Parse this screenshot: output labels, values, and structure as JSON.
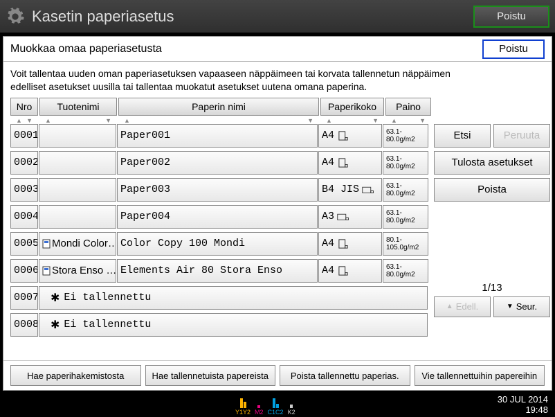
{
  "titlebar": {
    "title": "Kasetin paperiasetus",
    "exit": "Poistu"
  },
  "panel": {
    "title": "Muokkaa omaa paperiasetusta",
    "exit": "Poistu",
    "info1": "Voit tallentaa uuden oman paperiasetuksen vapaaseen näppäimeen tai korvata tallennetun näppäimen",
    "info2": "edelliset asetukset uusilla tai tallentaa muokatut asetukset uutena omana paperina."
  },
  "headers": {
    "nro": "Nro",
    "tuotenimi": "Tuotenimi",
    "paperin_nimi": "Paperin nimi",
    "paperikoko": "Paperikoko",
    "paino": "Paino"
  },
  "rows": [
    {
      "num": "0001",
      "brand": "",
      "pname": "Paper001",
      "psize": "A4",
      "icon": "portrait-dog",
      "w1": "63.1-",
      "w2": "80.0g/m2"
    },
    {
      "num": "0002",
      "brand": "",
      "pname": "Paper002",
      "psize": "A4",
      "icon": "portrait-dog",
      "w1": "63.1-",
      "w2": "80.0g/m2"
    },
    {
      "num": "0003",
      "brand": "",
      "pname": "Paper003",
      "psize": "B4 JIS",
      "icon": "landscape-dog",
      "w1": "63.1-",
      "w2": "80.0g/m2"
    },
    {
      "num": "0004",
      "brand": "",
      "pname": "Paper004",
      "psize": "A3",
      "icon": "landscape-dog",
      "w1": "63.1-",
      "w2": "80.0g/m2"
    },
    {
      "num": "0005",
      "brand": "Mondi Color…",
      "brand_icon": true,
      "pname": "Color Copy 100 Mondi",
      "psize": "A4",
      "icon": "portrait-dog",
      "w1": "80.1-",
      "w2": "105.0g/m2"
    },
    {
      "num": "0006",
      "brand": "Stora Enso …",
      "brand_icon": true,
      "pname": "Elements Air 80 Stora Enso",
      "psize": "A4",
      "icon": "portrait-dog",
      "w1": "63.1-",
      "w2": "80.0g/m2"
    },
    {
      "num": "0007",
      "notstored": "Ei tallennettu"
    },
    {
      "num": "0008",
      "notstored": "Ei tallennettu"
    }
  ],
  "side": {
    "etsi": "Etsi",
    "peruuta": "Peruuta",
    "tulosta": "Tulosta asetukset",
    "poista": "Poista"
  },
  "pager": {
    "num": "1/13",
    "prev": "Edell.",
    "next": "Seur."
  },
  "bottom": {
    "b1": "Hae paperihakemistosta",
    "b2": "Hae tallennetuista papereista",
    "b3": "Poista tallennettu paperias.",
    "b4": "Vie tallennettuihin papereihin"
  },
  "status": {
    "date": "30 JUL  2014",
    "time": "19:48",
    "toners": [
      {
        "label": "Y1Y2",
        "color": "#ffb400",
        "bars": [
          14,
          9
        ]
      },
      {
        "label": "M2",
        "color": "#e6007e",
        "bars": [
          4
        ]
      },
      {
        "label": "C1C2",
        "color": "#00a0e0",
        "bars": [
          14,
          6
        ]
      },
      {
        "label": "K2",
        "color": "#cccccc",
        "bars": [
          5
        ]
      }
    ]
  }
}
